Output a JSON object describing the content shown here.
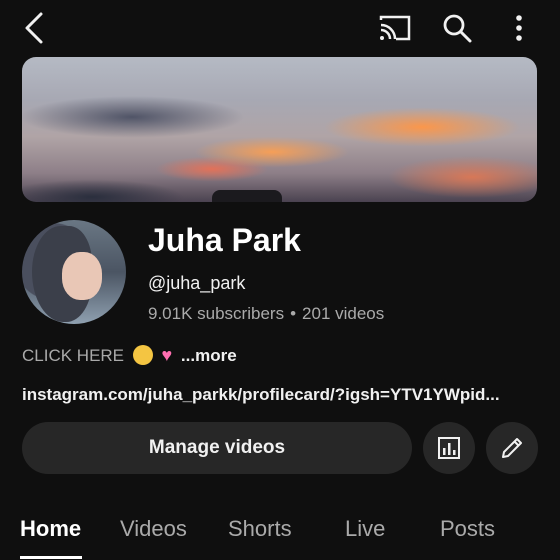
{
  "topbar": {
    "icons": [
      "back-icon",
      "cast-icon",
      "search-icon",
      "more-vert-icon"
    ]
  },
  "channel": {
    "name": "Juha Park",
    "handle": "@juha_park",
    "subscribers": "9.01K subscribers",
    "separator": "•",
    "videos": "201 videos",
    "description": "CLICK HERE",
    "more_label": "...more",
    "link": "instagram.com/juha_parkk/profilecard/?igsh=YTV1YWpid..."
  },
  "actions": {
    "manage_label": "Manage videos",
    "icons": [
      "analytics-icon",
      "edit-icon"
    ]
  },
  "tabs": [
    {
      "label": "Home",
      "active": true
    },
    {
      "label": "Videos",
      "active": false
    },
    {
      "label": "Shorts",
      "active": false
    },
    {
      "label": "Live",
      "active": false
    },
    {
      "label": "Posts",
      "active": false
    }
  ],
  "colors": {
    "background": "#0f0f0f",
    "button": "#272727",
    "muted_text": "#aaaaaa",
    "primary_text": "#f1f1f1"
  }
}
